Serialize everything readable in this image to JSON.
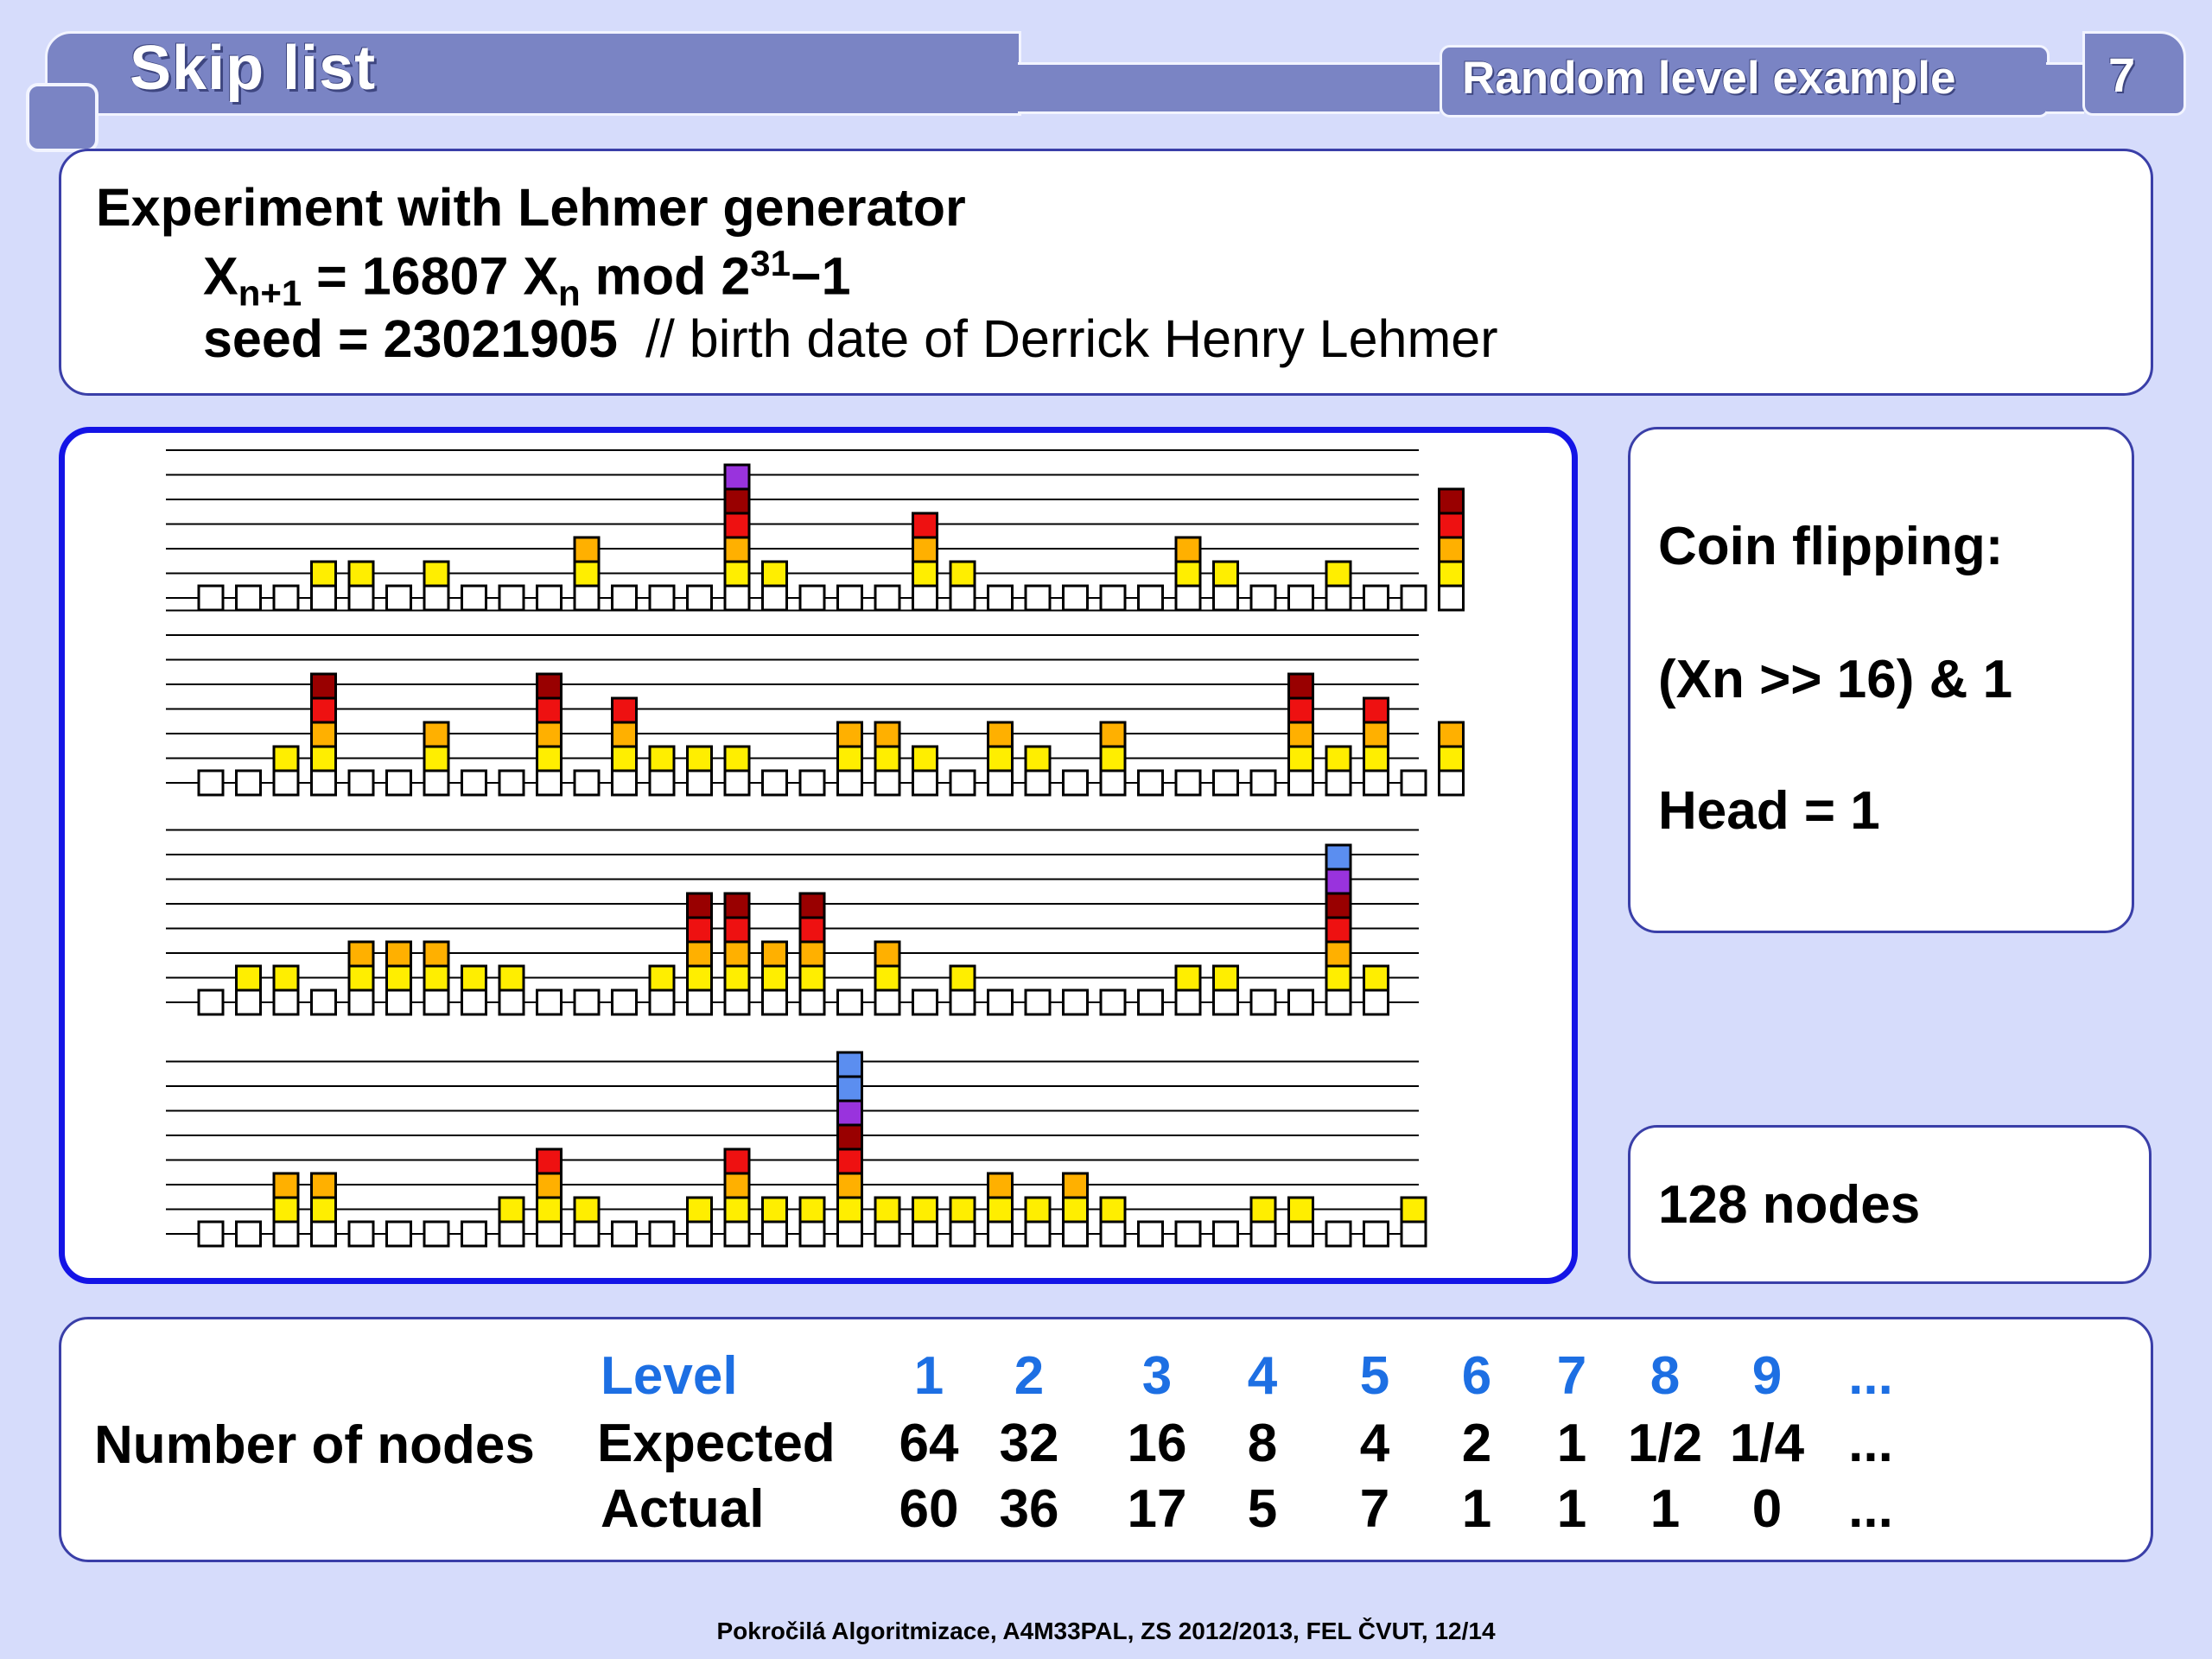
{
  "header": {
    "title": "Skip list",
    "subtitle": "Random level example",
    "page_number": "7"
  },
  "intro": {
    "heading": "Experiment with Lehmer generator",
    "formula": {
      "x": "X",
      "sub_left": "n+1",
      "middle": " = 16807 X",
      "sub_right": "n",
      "mod": " mod 2",
      "sup": "31",
      "tail": "−1"
    },
    "seed_label": "seed = 23021905",
    "seed_comment": "// birth date of Derrick Henry Lehmer"
  },
  "coin": {
    "line1": "Coin flipping:",
    "line2": "(Xn  >> 16) & 1",
    "line3": "Head = 1"
  },
  "nodes_label": "128 nodes",
  "table": {
    "row_label": "Number of nodes",
    "level_label": "Level",
    "expected_label": "Expected",
    "actual_label": "Actual",
    "levels": [
      "1",
      "2",
      "3",
      "4",
      "5",
      "6",
      "7",
      "8",
      "9",
      "..."
    ],
    "expected": [
      "64",
      "32",
      "16",
      "8",
      "4",
      "2",
      "1",
      "1/2",
      "1/4",
      "..."
    ],
    "actual": [
      "60",
      "36",
      "17",
      "5",
      "7",
      "1",
      "1",
      "1",
      "0",
      "..."
    ]
  },
  "footer": "Pokročilá Algoritmizace, A4M33PAL, ZS 2012/2013, FEL ČVUT,  12/14",
  "colors": {
    "header_tab": "#7a84c4",
    "chart_frame": "#1414e6",
    "level_colors": [
      "#ffffff",
      "#ffee00",
      "#ffb000",
      "#ee1111",
      "#990000",
      "#9933dd",
      "#5b8ef0"
    ]
  },
  "chart_data": {
    "type": "skip-list-levels",
    "rows": [
      [
        1,
        1,
        1,
        2,
        2,
        1,
        2,
        1,
        1,
        1,
        3,
        1,
        1,
        1,
        6,
        2,
        1,
        1,
        1,
        4,
        2,
        1,
        1,
        1,
        1,
        1,
        3,
        2,
        1,
        1,
        2,
        1,
        1,
        5
      ],
      [
        1,
        1,
        2,
        5,
        1,
        1,
        3,
        1,
        1,
        5,
        1,
        4,
        2,
        2,
        2,
        1,
        1,
        3,
        3,
        2,
        1,
        3,
        2,
        1,
        3,
        1,
        1,
        1,
        1,
        5,
        2,
        4,
        1,
        3
      ],
      [
        1,
        2,
        2,
        1,
        3,
        3,
        3,
        2,
        2,
        1,
        1,
        1,
        2,
        5,
        5,
        3,
        5,
        1,
        3,
        1,
        2,
        1,
        1,
        1,
        1,
        1,
        2,
        2,
        1,
        1,
        7,
        2
      ],
      [
        1,
        1,
        3,
        3,
        1,
        1,
        1,
        1,
        2,
        4,
        2,
        1,
        1,
        2,
        4,
        2,
        2,
        8,
        2,
        2,
        2,
        3,
        2,
        3,
        2,
        1,
        1,
        1,
        2,
        2,
        1,
        1,
        2
      ]
    ]
  }
}
